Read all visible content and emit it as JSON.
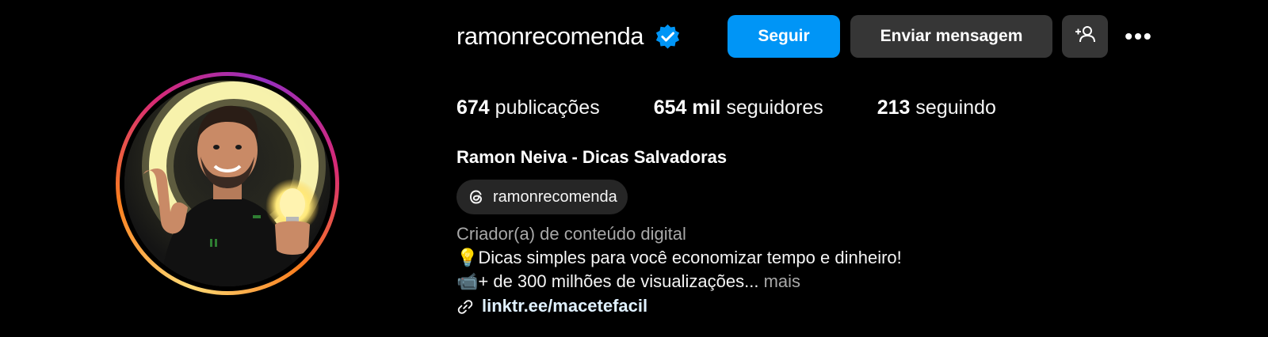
{
  "profile": {
    "username": "ramonrecomenda",
    "verified": true,
    "full_name": "Ramon Neiva - Dicas Salvadoras",
    "threads_handle": "ramonrecomenda",
    "category": "Criador(a) de conteúdo digital",
    "bio_line1": "💡Dicas simples para você economizar tempo e dinheiro!",
    "bio_line2": "📹+ de 300 milhões de visualizações...",
    "more_label": "mais",
    "link": "linktr.ee/macetefacil"
  },
  "buttons": {
    "follow": "Seguir",
    "message": "Enviar mensagem",
    "more": "•••"
  },
  "stats": {
    "posts_value": "674",
    "posts_label": "publicações",
    "followers_value": "654 mil",
    "followers_label": "seguidores",
    "following_value": "213",
    "following_label": "seguindo"
  },
  "icons": {
    "verified": "verified-badge-icon",
    "suggest": "add-person-icon",
    "threads": "threads-icon",
    "link": "link-icon"
  },
  "colors": {
    "background": "#000000",
    "accent": "#0095f6",
    "secondary_button": "#363636",
    "muted_text": "#a8a8a8",
    "link_text": "#e0f1ff",
    "pill_bg": "#262626"
  }
}
